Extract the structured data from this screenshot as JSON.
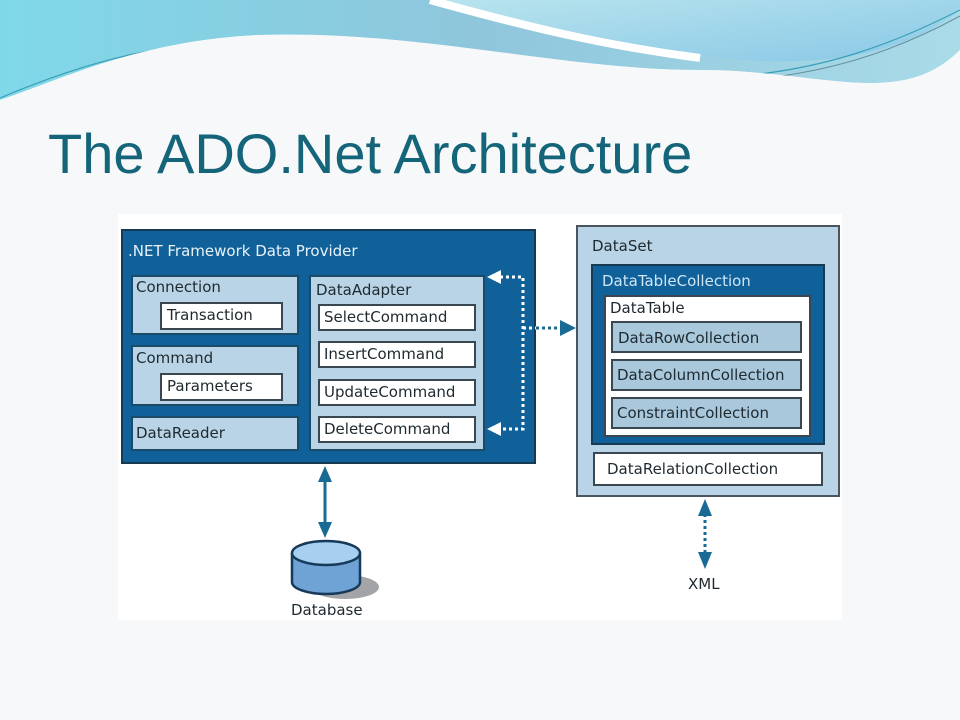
{
  "slide": {
    "title": "The ADO.Net Architecture"
  },
  "colors": {
    "title": "#15657a",
    "dark_blue": "#10609a",
    "light_blue": "#b9d4e6",
    "database_fill": "#7fb0dc",
    "arrow": "#1a6a96"
  },
  "provider": {
    "label": ".NET Framework Data Provider",
    "connection": {
      "label": "Connection",
      "child": "Transaction"
    },
    "command": {
      "label": "Command",
      "child": "Parameters"
    },
    "datareader": {
      "label": "DataReader"
    },
    "dataadapter": {
      "label": "DataAdapter",
      "commands": [
        "SelectCommand",
        "InsertCommand",
        "UpdateCommand",
        "DeleteCommand"
      ]
    }
  },
  "dataset": {
    "label": "DataSet",
    "datatablecollection": {
      "label": "DataTableCollection",
      "datatable": {
        "label": "DataTable",
        "collections": [
          "DataRowCollection",
          "DataColumnCollection",
          "ConstraintCollection"
        ]
      }
    },
    "datarelationcollection": "DataRelationCollection"
  },
  "endpoints": {
    "database": "Database",
    "xml": "XML"
  }
}
